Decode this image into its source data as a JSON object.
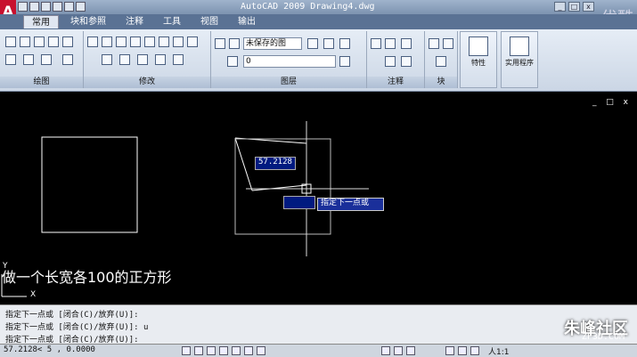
{
  "window": {
    "title": "AutoCAD 2009  Drawing4.dwg",
    "watermark_top": "优酷"
  },
  "tabs": [
    {
      "label": "常用",
      "active": true
    },
    {
      "label": "块和参照"
    },
    {
      "label": "注释"
    },
    {
      "label": "工具"
    },
    {
      "label": "视图"
    },
    {
      "label": "输出"
    }
  ],
  "ribbon": {
    "panels": [
      "绘图",
      "修改",
      "图层",
      "注释",
      "块"
    ],
    "layer_state": "未保存的图",
    "layer_current": "0",
    "big_buttons": [
      "特性",
      "实用程序"
    ]
  },
  "canvas": {
    "tooltip_value": "57.2128",
    "prompt_text": "指定下一点或",
    "caption": "做一个长宽各100的正方形",
    "ucs_x": "X",
    "ucs_y": "Y",
    "controls": "_ □ x"
  },
  "command": {
    "lines": [
      "指定下一点或 [闭合(C)/放弃(U)]:",
      "指定下一点或 [闭合(C)/放弃(U)]: u",
      "指定下一点或 [闭合(C)/放弃(U)]:"
    ]
  },
  "status": {
    "coords": "57.2128<  5      , 0.0000",
    "scale": "人1:1"
  },
  "watermark": {
    "name": "朱峰社区",
    "site": "ZF3D.COM"
  }
}
